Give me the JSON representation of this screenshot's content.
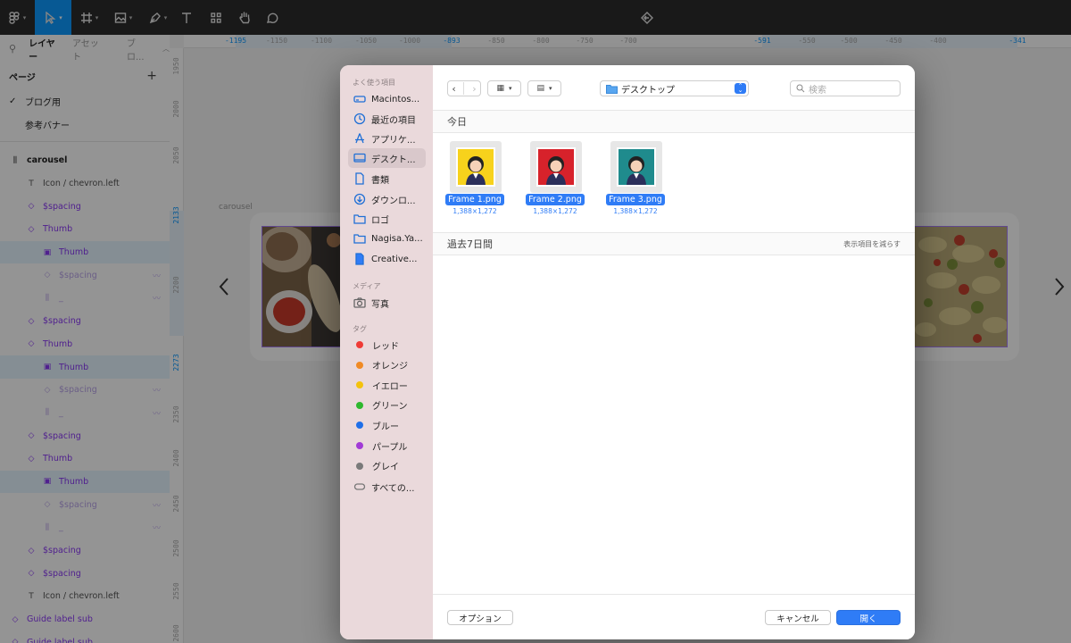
{
  "toolbar": {
    "tools": [
      "main-menu",
      "move",
      "frame",
      "image",
      "pen",
      "text",
      "components",
      "hand",
      "comment",
      "history"
    ]
  },
  "left_panel": {
    "tabs": {
      "layers": "レイヤー",
      "assets": "アセット",
      "page": "ブロ..."
    },
    "pages_label": "ページ",
    "add_page": "+",
    "pages": [
      {
        "name": "ブログ用",
        "current": true
      },
      {
        "name": "参考バナー",
        "current": false
      }
    ],
    "layers": [
      {
        "name": "carousel",
        "icon": "auto-layout-icon",
        "style": "bold"
      },
      {
        "name": "Icon / chevron.left",
        "icon": "text-icon",
        "style": "gray"
      },
      {
        "name": "$spacing",
        "icon": "diamond-icon",
        "style": "purple"
      },
      {
        "name": "Thumb",
        "icon": "diamond-icon",
        "style": "purple"
      },
      {
        "name": "Thumb",
        "icon": "image-icon",
        "style": "purple-sel"
      },
      {
        "name": "$spacing",
        "icon": "diamond-icon",
        "style": "faded"
      },
      {
        "name": "_",
        "icon": "auto-layout-icon",
        "style": "faded"
      },
      {
        "name": "$spacing",
        "icon": "diamond-icon",
        "style": "purple"
      },
      {
        "name": "Thumb",
        "icon": "diamond-icon",
        "style": "purple"
      },
      {
        "name": "Thumb",
        "icon": "image-icon",
        "style": "purple-sel"
      },
      {
        "name": "$spacing",
        "icon": "diamond-icon",
        "style": "faded"
      },
      {
        "name": "_",
        "icon": "auto-layout-icon",
        "style": "faded"
      },
      {
        "name": "$spacing",
        "icon": "diamond-icon",
        "style": "purple"
      },
      {
        "name": "Thumb",
        "icon": "diamond-icon",
        "style": "purple"
      },
      {
        "name": "Thumb",
        "icon": "image-icon",
        "style": "purple-sel"
      },
      {
        "name": "$spacing",
        "icon": "diamond-icon",
        "style": "faded"
      },
      {
        "name": "_",
        "icon": "auto-layout-icon",
        "style": "faded"
      },
      {
        "name": "$spacing",
        "icon": "diamond-icon",
        "style": "purple"
      },
      {
        "name": "$spacing",
        "icon": "diamond-icon",
        "style": "purple"
      },
      {
        "name": "Icon / chevron.left",
        "icon": "text-icon",
        "style": "gray"
      },
      {
        "name": "Guide label sub",
        "icon": "diamond-icon",
        "style": "purple"
      },
      {
        "name": "Guide label sub",
        "icon": "diamond-icon",
        "style": "purple"
      }
    ]
  },
  "canvas": {
    "frame_label": "carousel",
    "ruler_top": [
      "-1195",
      "-1150",
      "-1100",
      "-1050",
      "-1000",
      "-893",
      "-850",
      "-800",
      "-750",
      "-700",
      "-591",
      "-550",
      "-500",
      "-450",
      "-400",
      "-341"
    ],
    "ruler_top_highlight": [
      "-1195",
      "-893",
      "-591",
      "-341"
    ],
    "ruler_left": [
      "1950",
      "2000",
      "2050",
      "2133",
      "2200",
      "2273",
      "2350",
      "2400",
      "2450",
      "2500",
      "2550",
      "2600"
    ],
    "ruler_left_highlight": [
      "2133",
      "2273"
    ]
  },
  "dialog": {
    "sidebar": {
      "favorites_header": "よく使う項目",
      "favorites": [
        {
          "label": "Macintos...",
          "icon": "disk-icon"
        },
        {
          "label": "最近の項目",
          "icon": "clock-icon"
        },
        {
          "label": "アプリケ...",
          "icon": "apps-icon"
        },
        {
          "label": "デスクト...",
          "icon": "desktop-icon",
          "selected": true
        },
        {
          "label": "書類",
          "icon": "document-icon"
        },
        {
          "label": "ダウンロ...",
          "icon": "download-icon"
        },
        {
          "label": "ロゴ",
          "icon": "folder-icon"
        },
        {
          "label": "Nagisa.Ya...",
          "icon": "folder-icon"
        },
        {
          "label": "Creative...",
          "icon": "file-icon"
        }
      ],
      "media_header": "メディア",
      "media": [
        {
          "label": "写真",
          "icon": "camera-icon"
        }
      ],
      "tags_header": "タグ",
      "tags": [
        {
          "label": "レッド",
          "color": "#ef3b36"
        },
        {
          "label": "オレンジ",
          "color": "#f08a24"
        },
        {
          "label": "イエロー",
          "color": "#f4c20d"
        },
        {
          "label": "グリーン",
          "color": "#2eb82e"
        },
        {
          "label": "ブルー",
          "color": "#1f6fe8"
        },
        {
          "label": "パープル",
          "color": "#a23bd6"
        },
        {
          "label": "グレイ",
          "color": "#7a7a7a"
        }
      ],
      "all_tags": "すべての..."
    },
    "location": "デスクトップ",
    "search_placeholder": "検索",
    "today_header": "今日",
    "files": [
      {
        "name": "Frame 1.png",
        "size": "1,388×1,272",
        "bg": "#f7d21c",
        "selected": true
      },
      {
        "name": "Frame 2.png",
        "size": "1,388×1,272",
        "bg": "#d7222b",
        "selected": true
      },
      {
        "name": "Frame 3.png",
        "size": "1,388×1,272",
        "bg": "#1f8b8d",
        "selected": true
      }
    ],
    "week_header": "過去7日間",
    "show_less": "表示項目を減らす",
    "options_label": "オプション",
    "cancel_label": "キャンセル",
    "open_label": "開く"
  }
}
